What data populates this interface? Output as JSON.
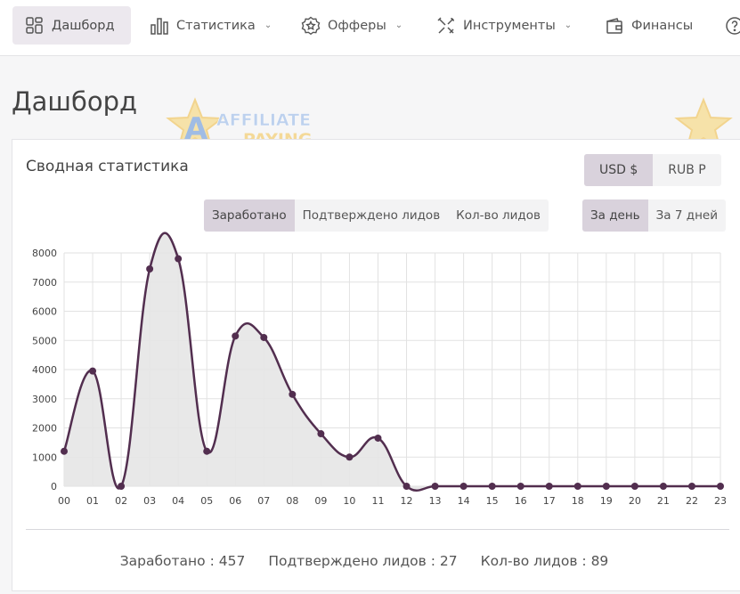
{
  "nav": {
    "items": [
      {
        "label": "Дашборд",
        "icon": "dashboard-icon",
        "active": true,
        "chevron": false
      },
      {
        "label": "Статистика",
        "icon": "bar-chart-icon",
        "active": false,
        "chevron": true
      },
      {
        "label": "Офферы",
        "icon": "badge-star-icon",
        "active": false,
        "chevron": true
      },
      {
        "label": "Инструменты",
        "icon": "tools-icon",
        "active": false,
        "chevron": true
      },
      {
        "label": "Финансы",
        "icon": "wallet-icon",
        "active": false,
        "chevron": false
      }
    ],
    "help_icon": "help-icon"
  },
  "page": {
    "title": "Дашборд"
  },
  "card": {
    "title": "Сводная статистика",
    "currency": {
      "options": [
        "USD $",
        "RUB Р"
      ],
      "selected": "USD $"
    },
    "metric": {
      "options": [
        "Заработано",
        "Подтверждено лидов",
        "Кол-во лидов"
      ],
      "selected": "Заработано"
    },
    "period": {
      "options": [
        "За день",
        "За 7 дней"
      ],
      "selected": "За день"
    }
  },
  "summary": {
    "earned_label": "Заработано",
    "earned_value": "457",
    "confirmed_label": "Подтверждено лидов",
    "confirmed_value": "27",
    "leads_label": "Кол-во лидов",
    "leads_value": "89"
  },
  "watermark": {
    "line1": "AFFILIATE",
    "line2": "PAYING"
  },
  "colors": {
    "accent": "#522e4f",
    "area": "#e5e5e5",
    "active_tab": "#d9d2dc"
  },
  "chart_data": {
    "type": "area",
    "categories": [
      "00",
      "01",
      "02",
      "03",
      "04",
      "05",
      "06",
      "07",
      "08",
      "09",
      "10",
      "11",
      "12",
      "13",
      "14",
      "15",
      "16",
      "17",
      "18",
      "19",
      "20",
      "21",
      "22",
      "23"
    ],
    "values": [
      1200,
      3950,
      0,
      7450,
      7800,
      1200,
      5150,
      5100,
      3150,
      1800,
      1000,
      1650,
      0,
      0,
      0,
      0,
      0,
      0,
      0,
      0,
      0,
      0,
      0,
      0
    ],
    "yticks": [
      0,
      1000,
      2000,
      3000,
      4000,
      5000,
      6000,
      7000,
      8000
    ],
    "ylim": [
      0,
      8000
    ],
    "grid": true,
    "smooth": true
  }
}
